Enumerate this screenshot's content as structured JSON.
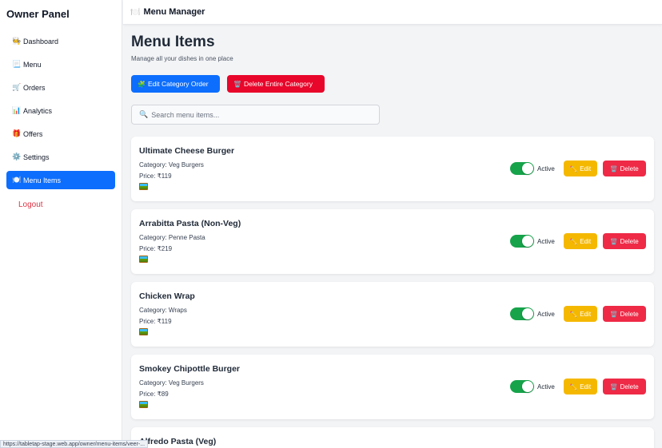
{
  "sidebar": {
    "brand": "Owner Panel",
    "items": [
      {
        "icon": "🧑‍🍳",
        "label": "Dashboard"
      },
      {
        "icon": "📃",
        "label": "Menu"
      },
      {
        "icon": "🛒",
        "label": "Orders"
      },
      {
        "icon": "📊",
        "label": "Analytics"
      },
      {
        "icon": "🎁",
        "label": "Offers"
      },
      {
        "icon": "⚙️",
        "label": "Settings"
      },
      {
        "icon": "🍽️",
        "label": "Menu Items"
      }
    ],
    "active_item": "Menu Items",
    "logout": "Logout"
  },
  "topbar": {
    "icon": "🍽️",
    "title": "Menu Manager"
  },
  "page": {
    "title": "Menu Items",
    "subtitle": "Manage all your dishes in one place",
    "edit_category_button": {
      "icon": "🧩",
      "label": "Edit Category Order"
    },
    "delete_category_button": {
      "icon": "🗑️",
      "label": "Delete Entire Category"
    },
    "search": {
      "icon": "🔍",
      "placeholder": "Search menu items..."
    }
  },
  "items": [
    {
      "name": "Ultimate Cheese Burger",
      "category": "Category: Veg Burgers",
      "price": "Price: ₹119",
      "status": "Active",
      "edit": "Edit",
      "delete": "Delete"
    },
    {
      "name": "Arrabitta Pasta (Non-Veg)",
      "category": "Category: Penne Pasta",
      "price": "Price: ₹219",
      "status": "Active",
      "edit": "Edit",
      "delete": "Delete"
    },
    {
      "name": "Chicken Wrap",
      "category": "Category: Wraps",
      "price": "Price: ₹119",
      "status": "Active",
      "edit": "Edit",
      "delete": "Delete"
    },
    {
      "name": "Smokey Chipottle Burger",
      "category": "Category: Veg Burgers",
      "price": "Price: ₹89",
      "status": "Active",
      "edit": "Edit",
      "delete": "Delete"
    },
    {
      "name": "Alfredo Pasta (Veg)"
    }
  ],
  "button_icons": {
    "edit": "✏️",
    "delete": "🗑️"
  },
  "colors": {
    "primary": "#0d6efd",
    "danger": "#e8062a",
    "warning": "#f5b800",
    "toggle_on": "#16a34a",
    "logout": "#dc3545"
  },
  "status_url": "https://tabletap-stage.web.app/owner/menu-items/veer-..."
}
